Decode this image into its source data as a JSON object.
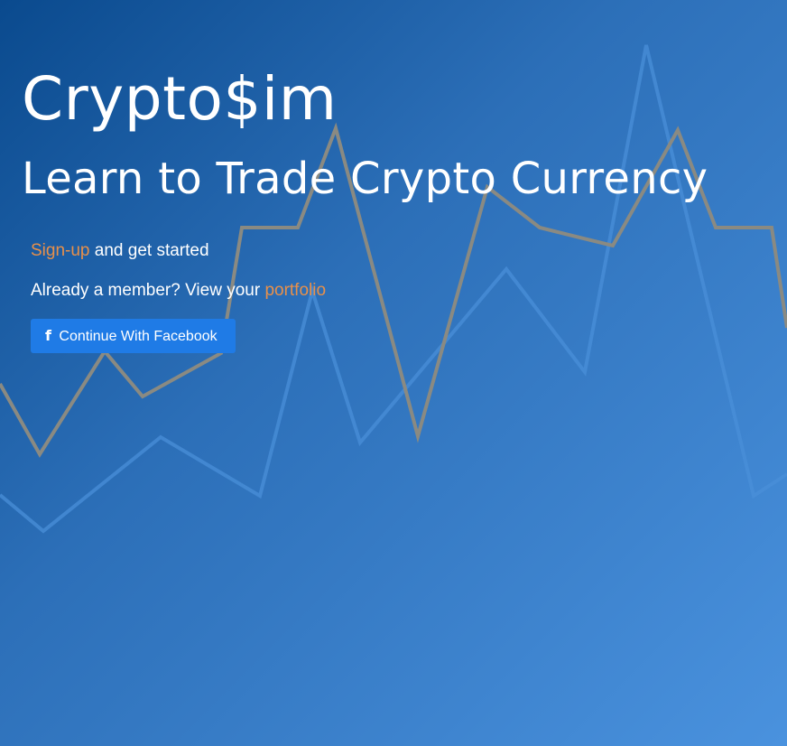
{
  "hero": {
    "brand": "Crypto$im",
    "tagline": "Learn to Trade Crypto Currency"
  },
  "signup_line": {
    "link_label": "Sign-up",
    "rest": " and get started"
  },
  "member_line": {
    "prefix": "Already a member? View your ",
    "link_label": "portfolio"
  },
  "facebook_button": {
    "icon": "facebook-icon",
    "glyph": "f",
    "label": "Continue With Facebook"
  },
  "colors": {
    "background_start": "#0a4a8e",
    "background_end": "#4a92de",
    "link": "#e8904a",
    "button": "#1f7be6",
    "chart_line_gray": "#8a8a82",
    "chart_line_blue": "#4a8fd8"
  }
}
